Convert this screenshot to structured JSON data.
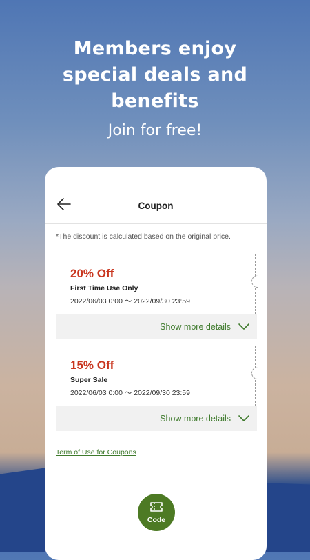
{
  "promo": {
    "headline_line1": "Members enjoy",
    "headline_line2": "special deals and",
    "headline_line3": "benefits",
    "subheadline": "Join for free!"
  },
  "app": {
    "title": "Coupon",
    "note": "*The discount is calculated based on the original price.",
    "coupons": [
      {
        "discount": "20% Off",
        "name": "First Time Use Only",
        "period": "2022/06/03 0:00 ～ 2022/09/30 23:59",
        "details_label": "Show more details"
      },
      {
        "discount": "15% Off",
        "name": "Super Sale",
        "period": "2022/06/03 0:00 ～ 2022/09/30 23:59",
        "details_label": "Show more details"
      }
    ],
    "terms_link": "Term of Use for Coupons",
    "code_button_label": "Code"
  },
  "colors": {
    "accent_green": "#4d7a24",
    "link_green": "#3e7a2c",
    "discount_red": "#c9361f"
  }
}
